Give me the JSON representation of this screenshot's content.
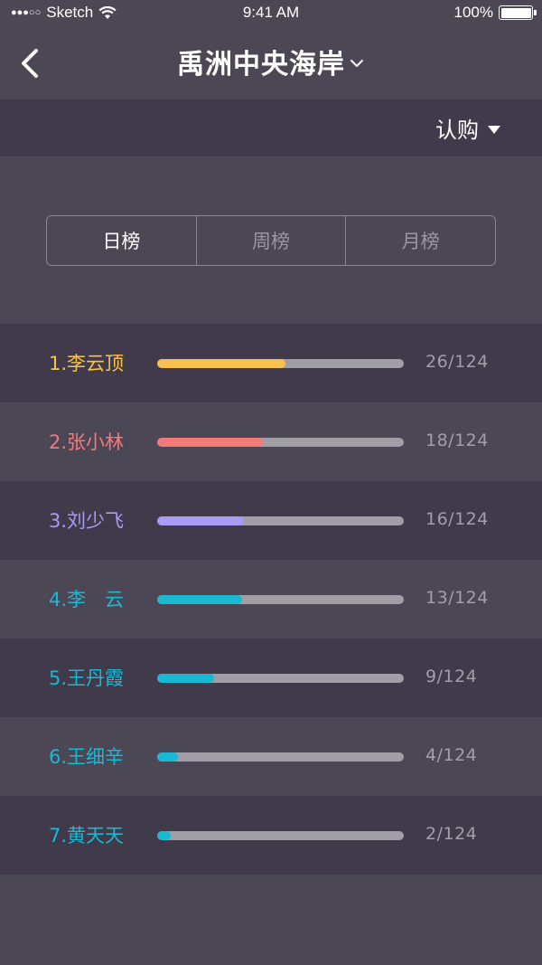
{
  "status_bar": {
    "signal": "●●●○○",
    "carrier": "Sketch",
    "time": "9:41 AM",
    "battery": "100%"
  },
  "nav": {
    "back_icon": "chevron-left-icon",
    "title": "禹洲中央海岸",
    "title_dropdown_icon": "chevron-down-icon"
  },
  "filter": {
    "selected": "认购",
    "dropdown_icon": "triangle-down-icon"
  },
  "tabs": [
    {
      "label": "日榜",
      "active": true
    },
    {
      "label": "周榜",
      "active": false
    },
    {
      "label": "月榜",
      "active": false
    }
  ],
  "ranking": [
    {
      "name": "1.李云顶",
      "count": "26/124",
      "color": "#f9c24f",
      "fill_fraction": 0.52
    },
    {
      "name": "2.张小林",
      "count": "18/124",
      "color": "#f47a7a",
      "fill_fraction": 0.43
    },
    {
      "name": "3.刘少飞",
      "count": "16/124",
      "color": "#a89bf5",
      "fill_fraction": 0.35
    },
    {
      "name": "4.李　云",
      "count": "13/124",
      "color": "#1ab9d3",
      "fill_fraction": 0.345
    },
    {
      "name": "5.王丹霞",
      "count": "9/124",
      "color": "#1ab9d3",
      "fill_fraction": 0.23
    },
    {
      "name": "6.王细辛",
      "count": "4/124",
      "color": "#1ab9d3",
      "fill_fraction": 0.085
    },
    {
      "name": "7.黄天天",
      "count": "2/124",
      "color": "#1ab9d3",
      "fill_fraction": 0.055
    }
  ]
}
